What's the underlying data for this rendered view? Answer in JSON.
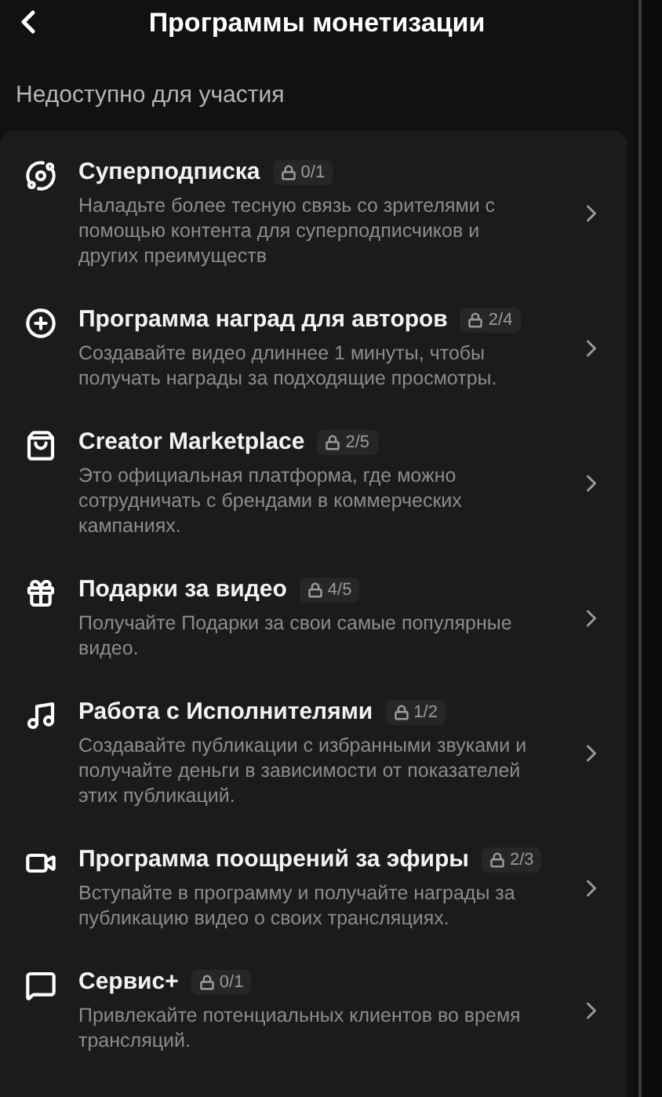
{
  "header": {
    "title": "Программы монетизации"
  },
  "section": {
    "title": "Недоступно для участия"
  },
  "programs": [
    {
      "kind": "planet",
      "title": "Суперподписка",
      "progress": "0/1",
      "description": "Наладьте более тесную связь со зрителями с помощью контента для суперподписчиков и других преимуществ"
    },
    {
      "kind": "plus",
      "title": "Программа наград для авторов",
      "progress": "2/4",
      "description": "Создавайте видео длиннее 1 минуты, чтобы получать награды за подходящие просмотры."
    },
    {
      "kind": "bag",
      "title": "Creator Marketplace",
      "progress": "2/5",
      "description": "Это официальная платформа, где можно сотрудничать с брендами в коммерческих кампаниях."
    },
    {
      "kind": "gift",
      "title": "Подарки за видео",
      "progress": "4/5",
      "description": "Получайте Подарки за свои самые популярные видео."
    },
    {
      "kind": "music",
      "title": "Работа с Исполнителями",
      "progress": "1/2",
      "description": "Создавайте публикации с избранными звуками и получайте деньги в зависимости от показателей этих публикаций."
    },
    {
      "kind": "video",
      "title": "Программа поощрений за эфиры",
      "progress": "2/3",
      "description": "Вступайте в программу и получайте награды за публикацию видео о своих трансляциях."
    },
    {
      "kind": "chat",
      "title": "Сервис+",
      "progress": "0/1",
      "description": "Привлекайте потенциальных клиентов во время трансляций."
    }
  ]
}
